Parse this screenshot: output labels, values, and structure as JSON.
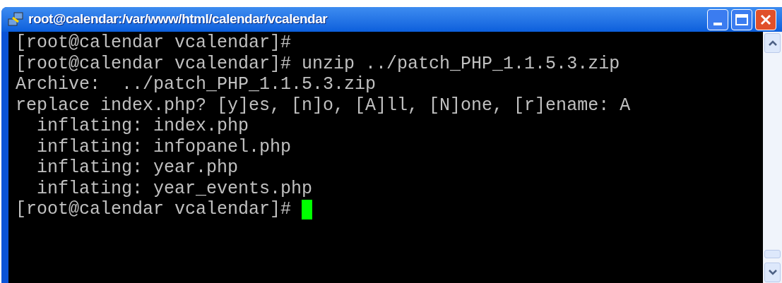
{
  "window": {
    "title": "root@calendar:/var/www/html/calendar/vcalendar"
  },
  "terminal": {
    "lines": [
      {
        "text": "[root@calendar vcalendar]#"
      },
      {
        "text": "[root@calendar vcalendar]# unzip ../patch_PHP_1.1.5.3.zip"
      },
      {
        "text": "Archive:  ../patch_PHP_1.1.5.3.zip"
      },
      {
        "text": "replace index.php? [y]es, [n]o, [A]ll, [N]one, [r]ename: A"
      },
      {
        "text": "  inflating: index.php"
      },
      {
        "text": "  inflating: infopanel.php"
      },
      {
        "text": "  inflating: year.php"
      },
      {
        "text": "  inflating: year_events.php"
      },
      {
        "text": "[root@calendar vcalendar]# ",
        "cursor": true
      }
    ]
  }
}
